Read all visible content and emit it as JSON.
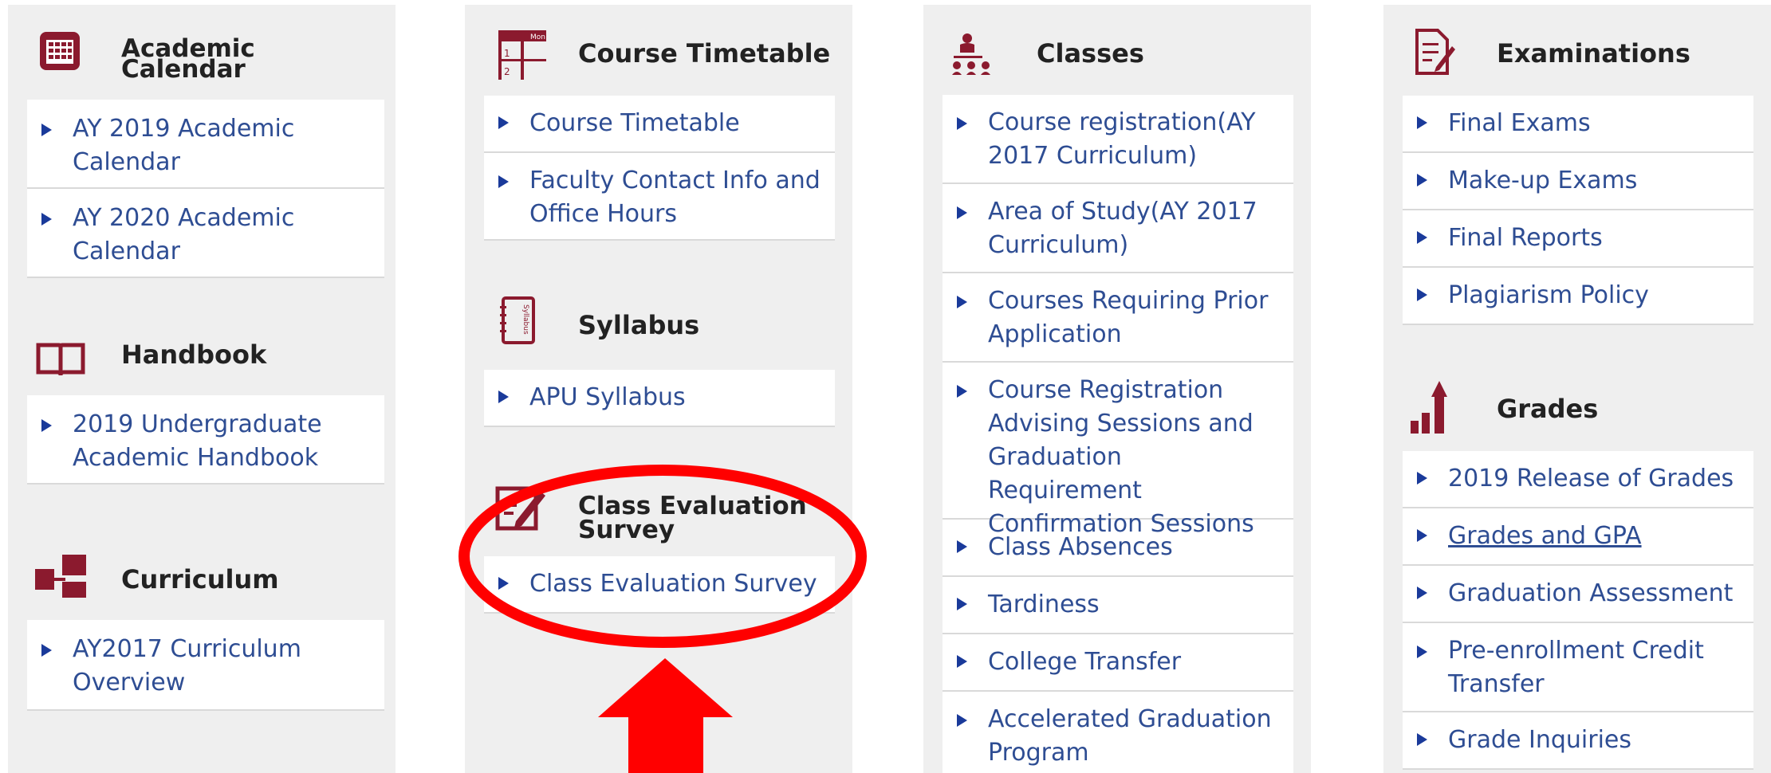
{
  "columns": [
    {
      "sections": [
        {
          "title": "Academic\nCalendar",
          "icon": "calendar-icon",
          "links": [
            "AY 2019 Academic Calendar",
            "AY 2020 Academic Calendar"
          ]
        },
        {
          "title": "Handbook",
          "icon": "book-icon",
          "links": [
            "2019 Undergraduate Academic Handbook"
          ]
        },
        {
          "title": "Curriculum",
          "icon": "curriculum-icon",
          "links": [
            "AY2017 Curriculum Overview"
          ]
        }
      ]
    },
    {
      "sections": [
        {
          "title": "Course Timetable",
          "icon": "timetable-icon",
          "icon_text": "Mon",
          "links": [
            "Course Timetable",
            "Faculty Contact Info and Office Hours"
          ]
        },
        {
          "title": "Syllabus",
          "icon": "syllabus-icon",
          "icon_text": "Syllabus",
          "links": [
            "APU Syllabus"
          ]
        },
        {
          "title": "Class Evaluation\nSurvey",
          "icon": "evaluation-icon",
          "links": [
            "Class Evaluation Survey"
          ]
        }
      ]
    },
    {
      "sections": [
        {
          "title": "Classes",
          "icon": "classes-icon",
          "links": [
            "Course registration(AY 2017 Curriculum)",
            "Area of Study(AY 2017 Curriculum)",
            "Courses Requiring Prior Application",
            "Course Registration Advising Sessions and Graduation Requirement Confirmation Sessions",
            "Class Absences",
            "Tardiness",
            "College Transfer",
            "Accelerated Graduation Program"
          ]
        }
      ]
    },
    {
      "sections": [
        {
          "title": "Examinations",
          "icon": "examinations-icon",
          "links": [
            "Final Exams",
            "Make-up Exams",
            "Final Reports",
            "Plagiarism Policy"
          ]
        },
        {
          "title": "Grades",
          "icon": "grades-icon",
          "links": [
            "2019 Release of Grades",
            "Grades and GPA",
            "Graduation Assessment",
            "Pre-enrollment Credit Transfer",
            "Grade Inquiries"
          ]
        }
      ]
    }
  ],
  "annotation": {
    "highlight_color": "#ff0000",
    "brand_color": "#8b1a2e",
    "link_color": "#2e4d93"
  }
}
